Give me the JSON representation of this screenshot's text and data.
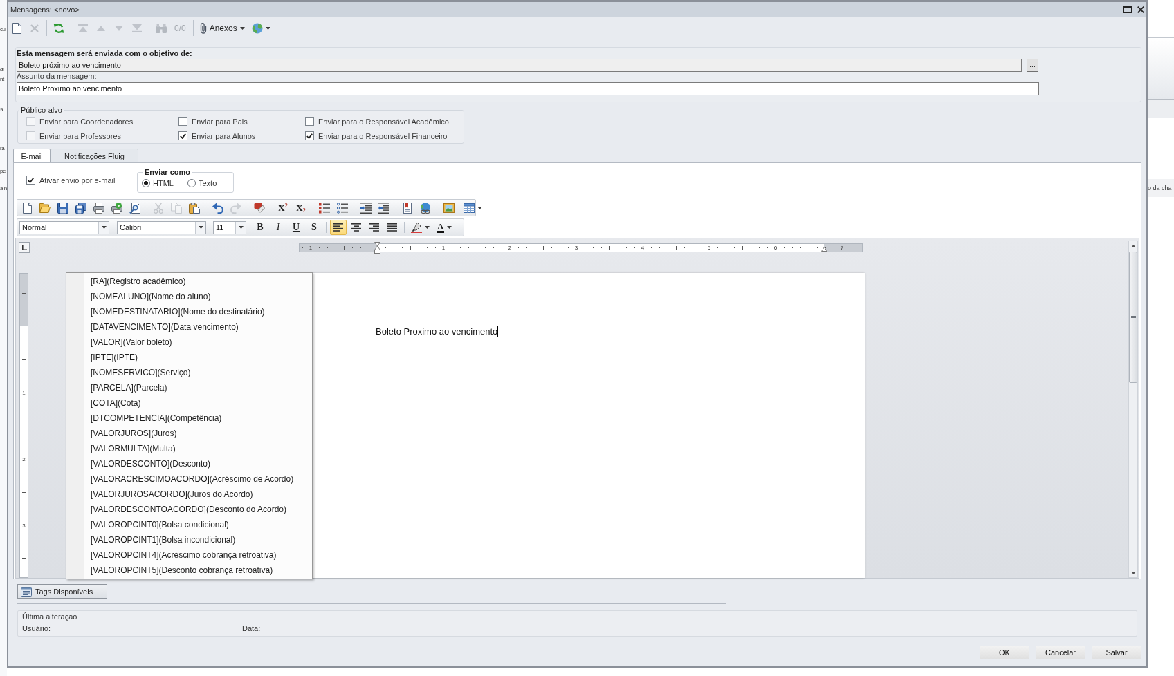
{
  "background": {
    "left_texts": [
      "cu",
      "ar",
      "nt",
      "9",
      "rã",
      "pe",
      "a n"
    ],
    "right_texts": [
      "o da cha"
    ]
  },
  "window": {
    "title": "Mensagens: <novo>"
  },
  "toolbar": {
    "groups": [
      {
        "items": [
          {
            "kind": "new",
            "disabled": false
          },
          {
            "kind": "delete",
            "disabled": true
          }
        ]
      },
      {
        "items": [
          {
            "kind": "refresh",
            "disabled": false
          }
        ]
      },
      {
        "items": [
          {
            "kind": "first",
            "disabled": true
          },
          {
            "kind": "previous",
            "disabled": true
          },
          {
            "kind": "next",
            "disabled": true
          },
          {
            "kind": "last",
            "disabled": true
          }
        ]
      },
      {
        "items": [
          {
            "kind": "find",
            "disabled": true
          },
          {
            "kind": "counter",
            "label": "0/0",
            "disabled": true
          }
        ]
      },
      {
        "items": [
          {
            "kind": "attach",
            "label": "Anexos",
            "disabled": false
          },
          {
            "kind": "web",
            "disabled": false
          }
        ]
      }
    ]
  },
  "objective": {
    "label": "Esta mensagem será enviada com o objetivo de:",
    "value": "Boleto próximo ao vencimento",
    "browse_label": "...",
    "subject_label": "Assunto da mensagem:",
    "subject_value": "Boleto Proximo ao vencimento"
  },
  "audience": {
    "title": "Público-alvo",
    "options": [
      {
        "label": "Enviar para Coordenadores",
        "checked": false,
        "disabled": true
      },
      {
        "label": "Enviar para Pais",
        "checked": false,
        "disabled": false
      },
      {
        "label": "Enviar para o Responsável Acadêmico",
        "checked": false,
        "disabled": false
      },
      {
        "label": "Enviar para Professores",
        "checked": false,
        "disabled": true
      },
      {
        "label": "Enviar para Alunos",
        "checked": true,
        "disabled": false
      },
      {
        "label": "Enviar para o Responsável Financeiro",
        "checked": true,
        "disabled": false
      }
    ]
  },
  "tabs": [
    {
      "label": "E-mail",
      "selected": true
    },
    {
      "label": "Notificações Fluig",
      "selected": false
    }
  ],
  "email": {
    "enable": {
      "label": "Ativar envio por e-mail",
      "checked": true
    },
    "send_as": {
      "title": "Enviar como",
      "options": [
        {
          "label": "HTML",
          "selected": true
        },
        {
          "label": "Texto",
          "selected": false
        }
      ]
    }
  },
  "editor": {
    "toolbar": {
      "groups": [
        {
          "items": [
            {
              "kind": "new",
              "disabled": false
            },
            {
              "kind": "open",
              "disabled": false
            },
            {
              "kind": "save",
              "disabled": false
            },
            {
              "kind": "saveall",
              "disabled": false
            },
            {
              "kind": "print",
              "disabled": false
            },
            {
              "kind": "preview",
              "disabled": false
            },
            {
              "kind": "search",
              "disabled": false
            }
          ]
        },
        {
          "items": [
            {
              "kind": "cut",
              "disabled": true
            },
            {
              "kind": "copy",
              "disabled": true
            },
            {
              "kind": "paste",
              "disabled": false
            }
          ]
        },
        {
          "items": [
            {
              "kind": "undo",
              "disabled": false
            },
            {
              "kind": "redo",
              "disabled": true
            }
          ]
        },
        {
          "items": [
            {
              "kind": "spelling",
              "disabled": false
            }
          ]
        },
        {
          "items": [
            {
              "kind": "superscript",
              "label": "X$^{2}$",
              "disabled": false
            },
            {
              "kind": "subscript",
              "label": "X$_{2}$",
              "disabled": false
            }
          ]
        },
        {
          "items": [
            {
              "kind": "numbered",
              "disabled": false
            },
            {
              "kind": "bulleted",
              "disabled": false
            }
          ]
        },
        {
          "items": [
            {
              "kind": "indent",
              "disabled": false
            },
            {
              "kind": "outdent",
              "disabled": false
            }
          ]
        },
        {
          "items": [
            {
              "kind": "bookmark",
              "disabled": false
            },
            {
              "kind": "hyperlink",
              "disabled": false
            }
          ]
        },
        {
          "items": [
            {
              "kind": "image",
              "disabled": false
            }
          ]
        },
        {
          "items": [
            {
              "kind": "table",
              "disabled": false
            }
          ]
        }
      ]
    },
    "format_bar": {
      "style": "Normal",
      "font": "Calibri",
      "size": "11",
      "text_format": [
        {
          "kind": "bold",
          "label": "B"
        },
        {
          "kind": "italic",
          "label": "I"
        },
        {
          "kind": "underline",
          "label": "U"
        },
        {
          "kind": "strike",
          "label": "S"
        }
      ],
      "alignment": [
        {
          "kind": "left",
          "selected": true
        },
        {
          "kind": "center",
          "selected": false
        },
        {
          "kind": "right",
          "selected": false
        },
        {
          "kind": "justify",
          "selected": false
        }
      ],
      "colors": [
        {
          "kind": "highlight"
        },
        {
          "kind": "fontcolor",
          "label": "A"
        }
      ]
    },
    "ruler": {
      "labels": [
        "1",
        "1",
        "2",
        "3",
        "4",
        "5",
        "6",
        "7"
      ]
    },
    "vertical_ruler": {
      "labels": [
        "1",
        "2",
        "3"
      ]
    },
    "document": {
      "text": "Boleto Proximo ao vencimento"
    }
  },
  "tags_menu": {
    "items": [
      {
        "label": "[RA](Registro acadêmico)",
        "selected": false
      },
      {
        "label": "[NOMEALUNO](Nome do aluno)",
        "selected": false
      },
      {
        "label": "[NOMEDESTINATARIO](Nome do destinatário)",
        "selected": false
      },
      {
        "label": "[DATAVENCIMENTO](Data vencimento)",
        "selected": false
      },
      {
        "label": "[VALOR](Valor boleto)",
        "selected": false
      },
      {
        "label": "[IPTE](IPTE)",
        "selected": false
      },
      {
        "label": "[NOMESERVICO](Serviço)",
        "selected": false
      },
      {
        "label": "[PARCELA](Parcela)",
        "selected": false
      },
      {
        "label": "[COTA](Cota)",
        "selected": false
      },
      {
        "label": "[DTCOMPETENCIA](Competência)",
        "selected": false
      },
      {
        "label": "[VALORJUROS](Juros)",
        "selected": false
      },
      {
        "label": "[VALORMULTA](Multa)",
        "selected": false
      },
      {
        "label": "[VALORDESCONTO](Desconto)",
        "selected": false
      },
      {
        "label": "[VALORACRESCIMOACORDO](Acréscimo de Acordo)",
        "selected": false
      },
      {
        "label": "[VALORJUROSACORDO](Juros do Acordo)",
        "selected": false
      },
      {
        "label": "[VALORDESCONTOACORDO](Desconto do Acordo)",
        "selected": false
      },
      {
        "label": "[VALOROPCINT0](Bolsa condicional)",
        "selected": false
      },
      {
        "label": "[VALOROPCINT1](Bolsa incondicional)",
        "selected": false
      },
      {
        "label": "[VALOROPCINT4](Acréscimo cobrança retroativa)",
        "selected": false
      },
      {
        "label": "[VALOROPCINT5](Desconto cobrança retroativa)",
        "selected": false
      }
    ]
  },
  "tags_button": {
    "label": "Tags Disponíveis"
  },
  "last_change": {
    "title": "Última alteração",
    "fields": [
      {
        "label": "Usuário:"
      },
      {
        "label": "Data:"
      }
    ]
  },
  "buttons": [
    {
      "label": "OK"
    },
    {
      "label": "Cancelar"
    },
    {
      "label": "Salvar"
    }
  ]
}
